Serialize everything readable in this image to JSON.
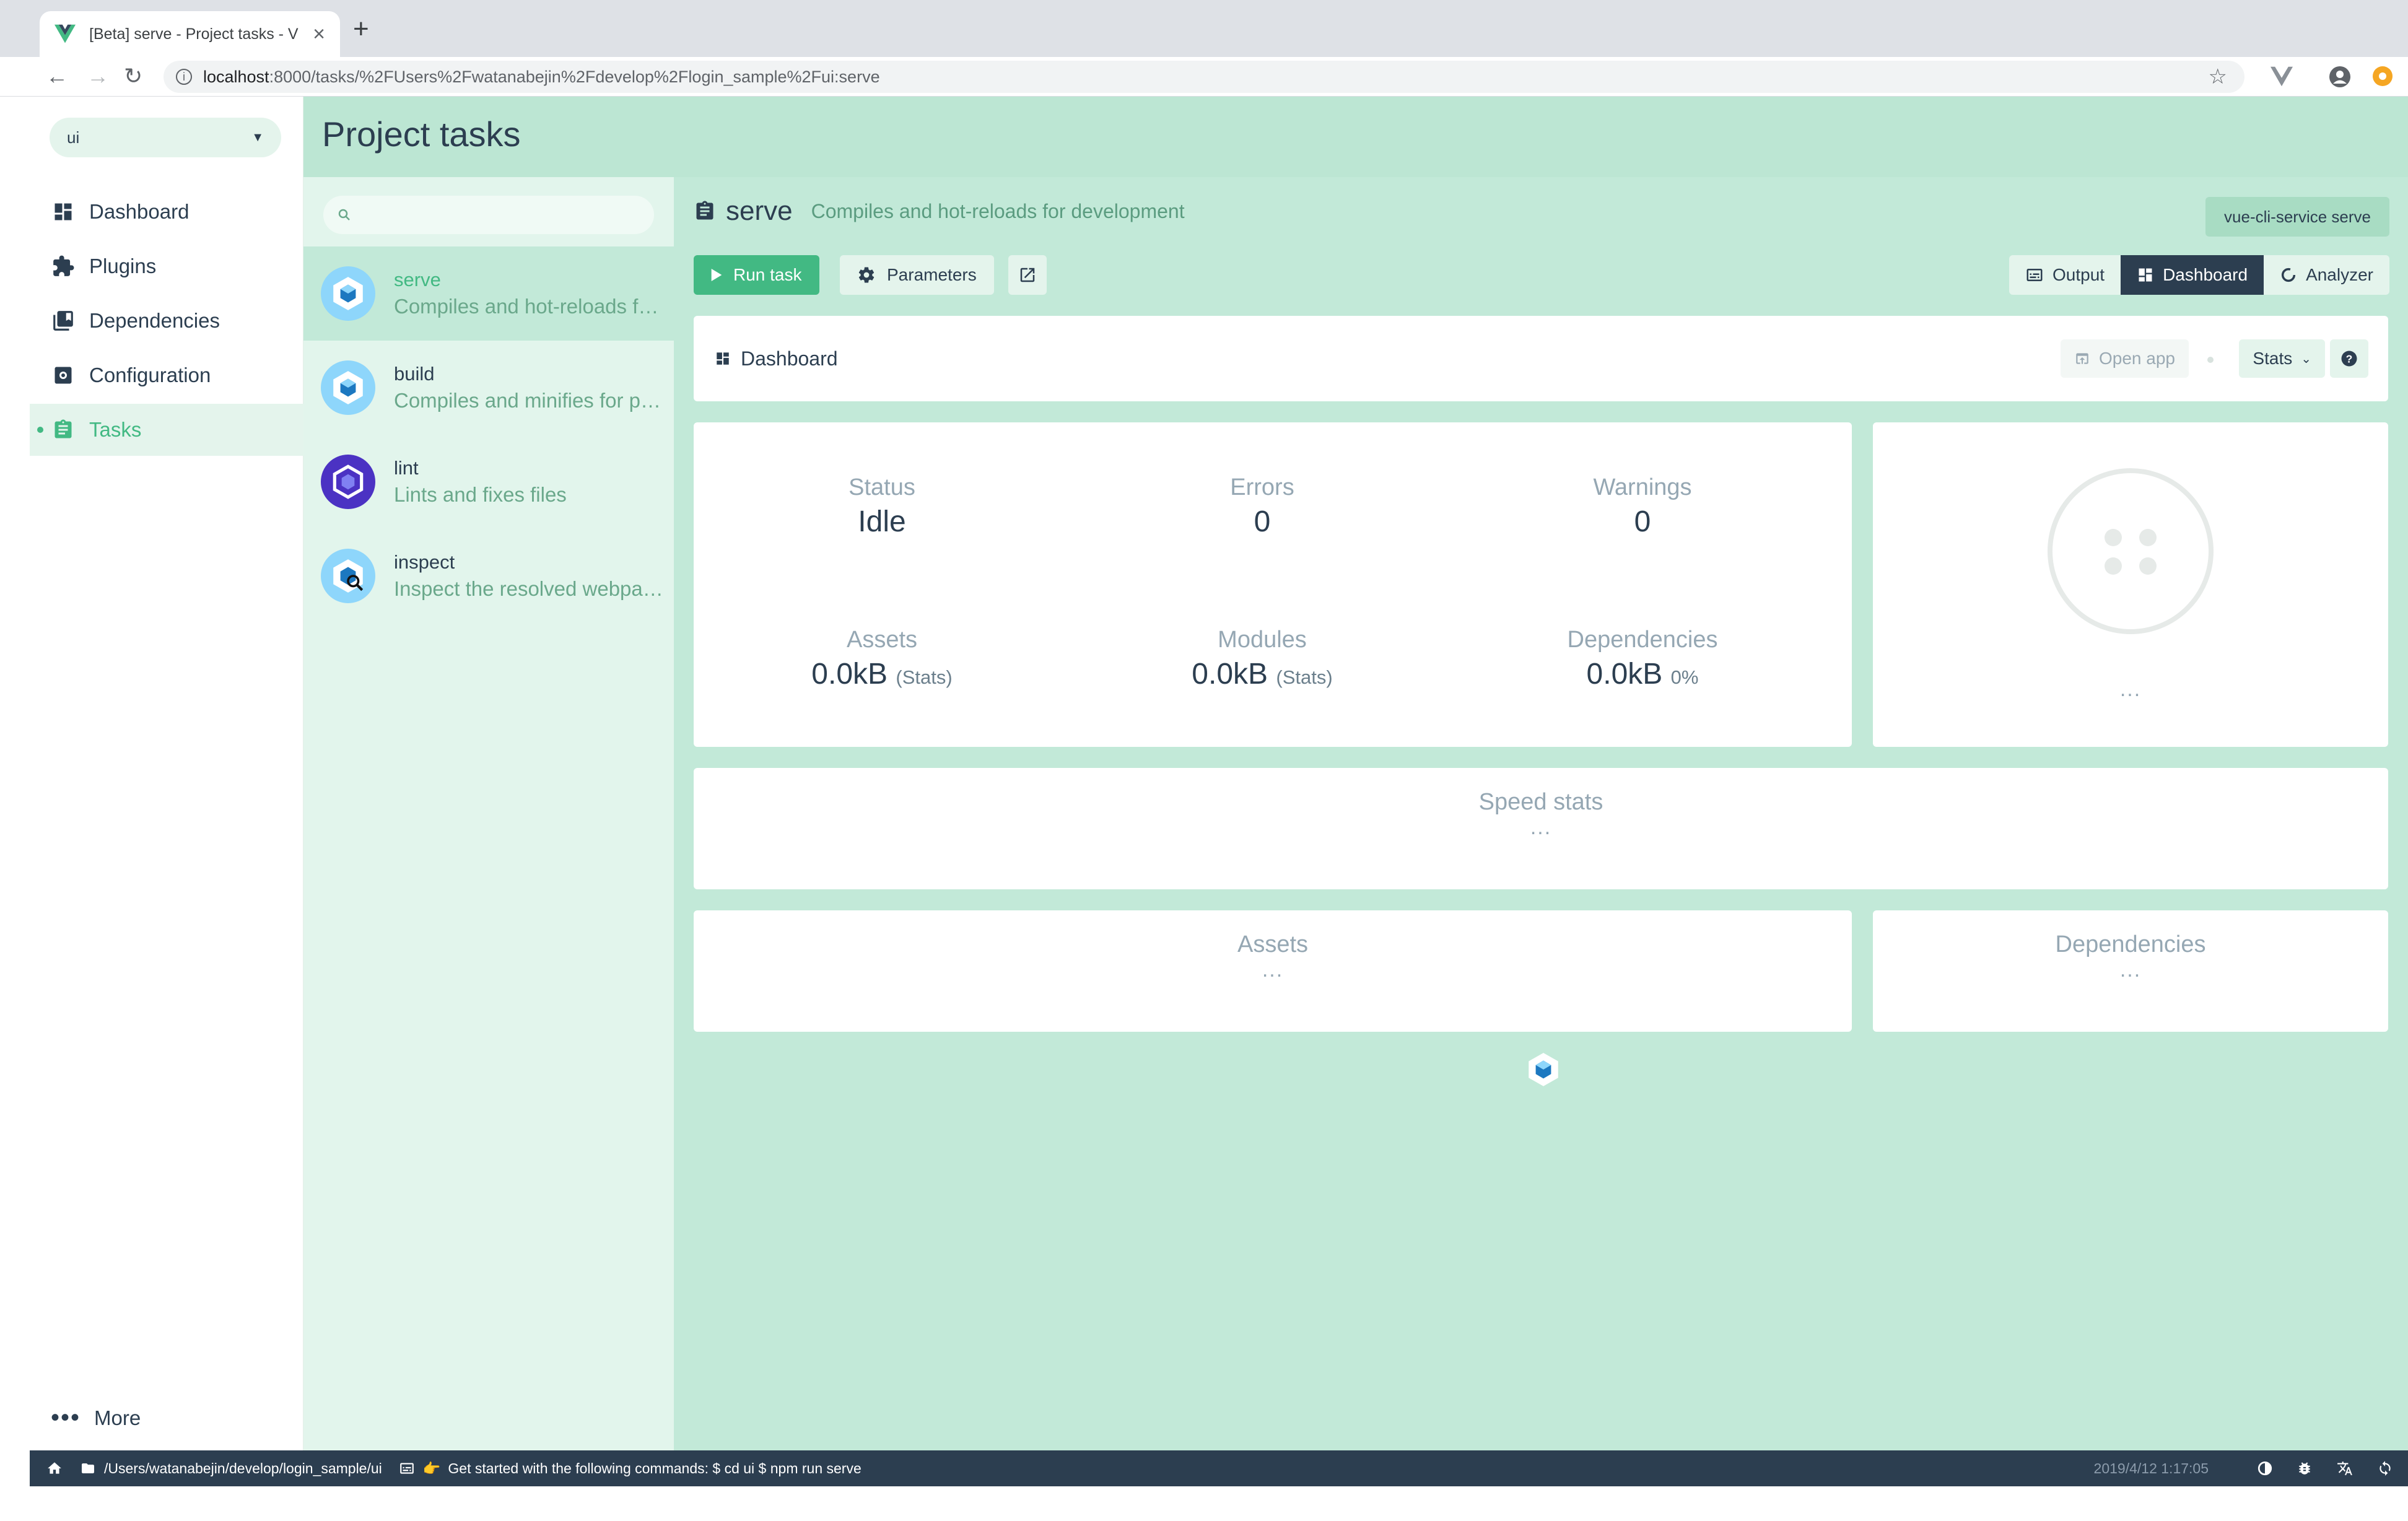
{
  "browser": {
    "tab_title": "[Beta] serve - Project tasks - V",
    "url_host": "localhost",
    "url_rest": ":8000/tasks/%2FUsers%2Fwatanabejin%2Fdevelop%2Flogin_sample%2Fui:serve"
  },
  "sidebar": {
    "project": "ui",
    "items": [
      {
        "label": "Dashboard",
        "icon": "dashboard-icon"
      },
      {
        "label": "Plugins",
        "icon": "puzzle-icon"
      },
      {
        "label": "Dependencies",
        "icon": "collections-icon"
      },
      {
        "label": "Configuration",
        "icon": "settings-applications-icon"
      },
      {
        "label": "Tasks",
        "icon": "assignment-icon",
        "active": true
      }
    ],
    "more_label": "More"
  },
  "page": {
    "title": "Project tasks",
    "search_placeholder": ""
  },
  "tasks": [
    {
      "name": "serve",
      "description": "Compiles and hot-reloads for development",
      "selected": true
    },
    {
      "name": "build",
      "description": "Compiles and minifies for production"
    },
    {
      "name": "lint",
      "description": "Lints and fixes files"
    },
    {
      "name": "inspect",
      "description": "Inspect the resolved webpack config"
    }
  ],
  "task_detail": {
    "name": "serve",
    "description": "Compiles and hot-reloads for development",
    "command": "vue-cli-service serve",
    "run_label": "Run task",
    "params_label": "Parameters",
    "views": {
      "output": "Output",
      "dashboard": "Dashboard",
      "analyzer": "Analyzer"
    }
  },
  "dashboard": {
    "title": "Dashboard",
    "open_app": "Open app",
    "stats_select": "Stats",
    "stats": {
      "status": {
        "label": "Status",
        "value": "Idle"
      },
      "errors": {
        "label": "Errors",
        "value": "0"
      },
      "warnings": {
        "label": "Warnings",
        "value": "0"
      },
      "assets": {
        "label": "Assets",
        "value": "0.0kB",
        "sub": "(Stats)"
      },
      "modules": {
        "label": "Modules",
        "value": "0.0kB",
        "sub": "(Stats)"
      },
      "dependencies": {
        "label": "Dependencies",
        "value": "0.0kB",
        "sub": "0%"
      }
    },
    "progress_ellipsis": "...",
    "speed_title": "Speed stats",
    "speed_ellipsis": "...",
    "assets_title": "Assets",
    "assets_ellipsis": "...",
    "deps_title": "Dependencies",
    "deps_ellipsis": "..."
  },
  "statusbar": {
    "path": "/Users/watanabejin/develop/login_sample/ui",
    "message": "Get started with the following commands: $ cd ui $ npm run serve",
    "time": "2019/4/12 1:17:05"
  },
  "colors": {
    "accent": "#42b983",
    "dark": "#2c3e50",
    "main_bg": "#c2e9d8"
  }
}
